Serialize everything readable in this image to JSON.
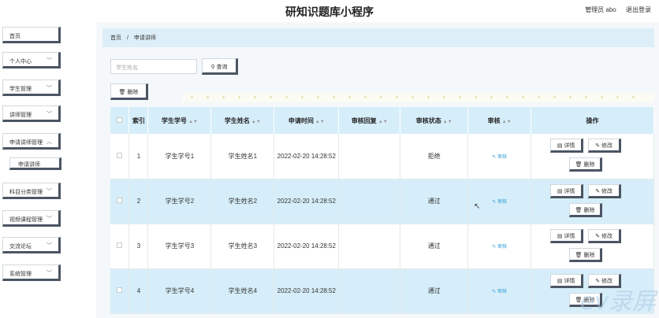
{
  "header": {
    "title": "研知识题库小程序",
    "user": "管理员 abo",
    "logout": "退出登录"
  },
  "sidebar": {
    "items": [
      {
        "label": "首页",
        "chevron": false
      },
      {
        "label": "个人中心",
        "chevron": true
      },
      {
        "label": "学生管理",
        "chevron": true
      },
      {
        "label": "讲师管理",
        "chevron": true
      },
      {
        "label": "申请讲师管理",
        "chevron": true
      },
      {
        "label": "科目分类管理",
        "chevron": true
      },
      {
        "label": "视频课程管理",
        "chevron": true
      },
      {
        "label": "交流论坛",
        "chevron": true
      },
      {
        "label": "系统管理",
        "chevron": true
      }
    ],
    "subitem": "申请讲师"
  },
  "breadcrumb": {
    "home": "首页",
    "separator": "/",
    "current": "申请讲师"
  },
  "search": {
    "placeholder": "学生姓名",
    "button": "查询"
  },
  "toolbar": {
    "delete": "删除"
  },
  "table": {
    "columns": [
      "索引",
      "学生学号",
      "学生姓名",
      "申请时间",
      "审核回复",
      "审核状态",
      "审核",
      "操作"
    ],
    "rows": [
      {
        "index": "1",
        "student_no": "学生学号1",
        "student_name": "学生姓名1",
        "time": "2022-02-20 14:28:52",
        "reply": "",
        "status": "拒绝",
        "audit": "审核"
      },
      {
        "index": "2",
        "student_no": "学生学号2",
        "student_name": "学生姓名2",
        "time": "2022-02-20 14:28:52",
        "reply": "",
        "status": "通过",
        "audit": "审核"
      },
      {
        "index": "3",
        "student_no": "学生学号3",
        "student_name": "学生姓名3",
        "time": "2022-02-20 14:28:52",
        "reply": "",
        "status": "通过",
        "audit": "审核"
      },
      {
        "index": "4",
        "student_no": "学生学号4",
        "student_name": "学生姓名4",
        "time": "2022-02-20 14:28:52",
        "reply": "",
        "status": "通过",
        "audit": "审核"
      }
    ],
    "actions": {
      "detail": "详情",
      "edit": "修改",
      "delete": "删除"
    }
  },
  "watermark": "ev录屏",
  "colors": {
    "header_row": "#d6eef9",
    "button_shadow": "#4b5563",
    "link": "#2f9bd6"
  }
}
